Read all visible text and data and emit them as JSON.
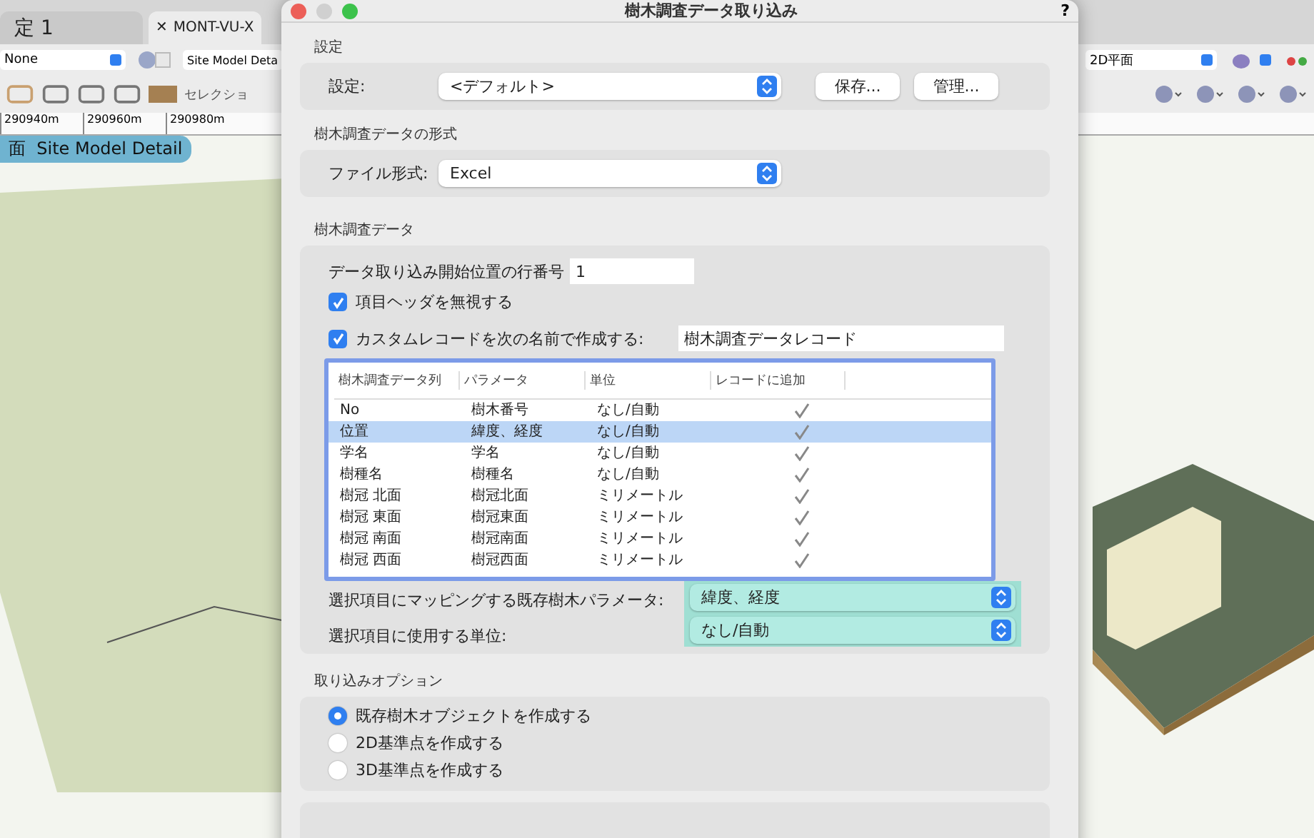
{
  "background_app": {
    "tabs": [
      {
        "label": "定 1",
        "selected": false
      },
      {
        "close_glyph": "✕",
        "label": "MONT-VU-X",
        "selected": true
      }
    ],
    "view_dropdown": "None",
    "layer_field": "Site Model Deta",
    "toolbar_label": "セレクショ",
    "ruler_ticks": [
      "290940m",
      "290960m",
      "290980m"
    ],
    "viewport_label": "面  Site Model Detail",
    "right_view_dropdown": "2D平面"
  },
  "dialog": {
    "title": "樹木調査データ取り込み",
    "help": "?",
    "settings": {
      "heading": "設定",
      "label": "設定:",
      "value": "<デフォルト>",
      "buttons": [
        "保存...",
        "管理..."
      ]
    },
    "format": {
      "heading": "樹木調査データの形式",
      "label": "ファイル形式:",
      "value": "Excel"
    },
    "data": {
      "heading": "樹木調査データ",
      "start_row_label": "データ取り込み開始位置の行番号",
      "start_row_value": "1",
      "checkboxes": [
        {
          "label": "項目ヘッダを無視する",
          "checked": true
        },
        {
          "label": "カスタムレコードを次の名前で作成する:",
          "checked": true,
          "value": "樹木調査データレコード"
        }
      ],
      "table": {
        "columns": [
          "樹木調査データ列",
          "パラメータ",
          "単位",
          "レコードに追加"
        ],
        "rows": [
          {
            "column": "No",
            "parameter": "樹木番号",
            "unit": "なし/自動",
            "added": true,
            "selected": false
          },
          {
            "column": "位置",
            "parameter": "緯度、経度",
            "unit": "なし/自動",
            "added": true,
            "selected": true
          },
          {
            "column": "学名",
            "parameter": "学名",
            "unit": "なし/自動",
            "added": true,
            "selected": false
          },
          {
            "column": "樹種名",
            "parameter": "樹種名",
            "unit": "なし/自動",
            "added": true,
            "selected": false
          },
          {
            "column": "樹冠 北面",
            "parameter": "樹冠北面",
            "unit": "ミリメートル",
            "added": true,
            "selected": false
          },
          {
            "column": "樹冠 東面",
            "parameter": "樹冠東面",
            "unit": "ミリメートル",
            "added": true,
            "selected": false
          },
          {
            "column": "樹冠 南面",
            "parameter": "樹冠南面",
            "unit": "ミリメートル",
            "added": true,
            "selected": false
          },
          {
            "column": "樹冠 西面",
            "parameter": "樹冠西面",
            "unit": "ミリメートル",
            "added": true,
            "selected": false
          }
        ]
      },
      "mapping": [
        {
          "label": "選択項目にマッピングする既存樹木パラメータ:",
          "value": "緯度、経度"
        },
        {
          "label": "選択項目に使用する単位:",
          "value": "なし/自動"
        }
      ]
    },
    "options": {
      "heading": "取り込みオプション",
      "radios": [
        {
          "label": "既存樹木オブジェクトを作成する",
          "selected": true
        },
        {
          "label": "2D基準点を作成する",
          "selected": false
        },
        {
          "label": "3D基準点を作成する",
          "selected": false
        }
      ]
    }
  }
}
